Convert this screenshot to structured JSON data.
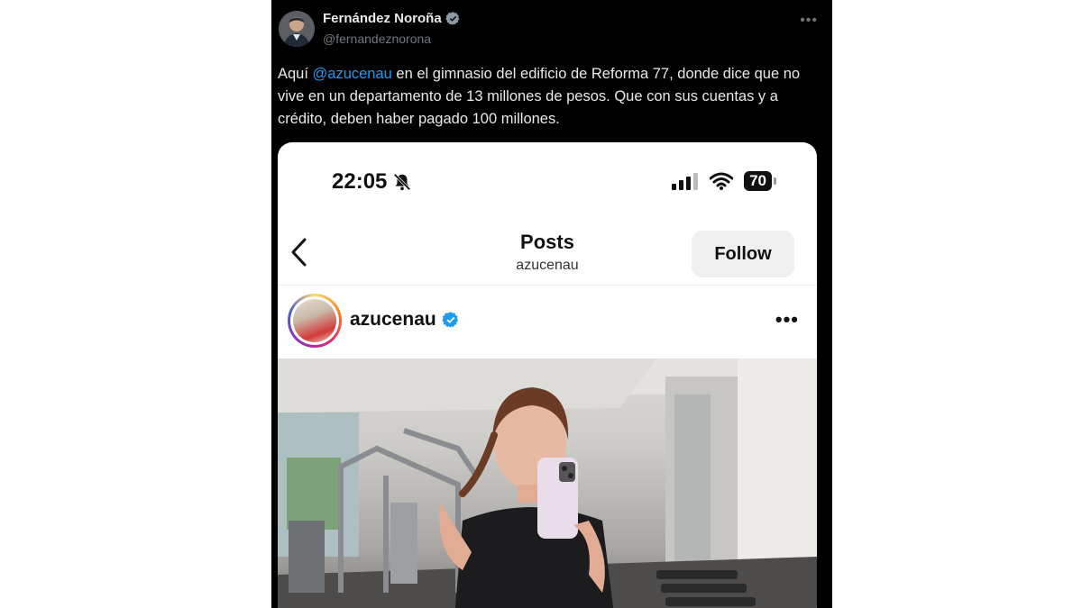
{
  "tweet": {
    "display_name": "Fernández Noroña",
    "handle": "@fernandeznorona",
    "text_before": "Aquí ",
    "mention": "@azucenau",
    "text_after": " en el gimnasio del edificio de Reforma 77, donde dice que no vive en un departamento de 13 millones de pesos. Que con sus cuentas y a crédito, deben haber pagado 100 millones.",
    "more_icon": "more-horizontal-icon",
    "verified_icon": "verified-badge-icon"
  },
  "screenshot": {
    "status_bar": {
      "time": "22:05",
      "battery": "70"
    },
    "nav": {
      "title": "Posts",
      "subtitle": "azucenau",
      "follow_label": "Follow"
    },
    "post": {
      "username": "azucenau",
      "more_icon": "more-horizontal-icon"
    }
  },
  "colors": {
    "background": "#000000",
    "text": "#e7e9ea",
    "secondary_text": "#71767b",
    "link": "#1d9bf0",
    "verified": "#1d9bf0"
  }
}
